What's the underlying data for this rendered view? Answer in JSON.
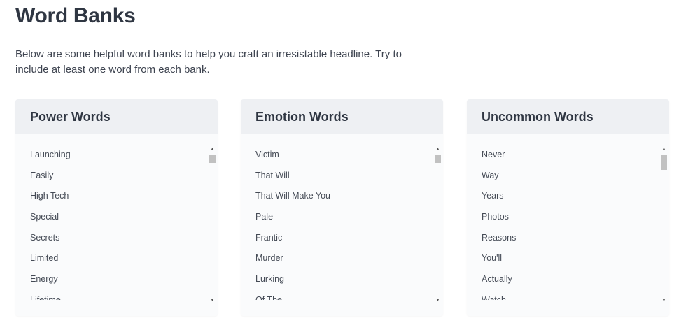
{
  "page": {
    "title": "Word Banks",
    "intro": "Below are some helpful word banks to help you craft an irresistable headline. Try to include at least one word from each bank."
  },
  "banks": [
    {
      "title": "Power Words",
      "items": [
        "Launching",
        "Easily",
        "High Tech",
        "Special",
        "Secrets",
        "Limited",
        "Energy",
        "Lifetime"
      ]
    },
    {
      "title": "Emotion Words",
      "items": [
        "Victim",
        "That Will",
        "That Will Make You",
        "Pale",
        "Frantic",
        "Murder",
        "Lurking",
        "Of The"
      ]
    },
    {
      "title": "Uncommon Words",
      "items": [
        "Never",
        "Way",
        "Years",
        "Photos",
        "Reasons",
        "You'll",
        "Actually",
        "Watch"
      ]
    }
  ],
  "icons": {
    "scroll_up": "scroll-up-arrow-icon",
    "scroll_down": "scroll-down-arrow-icon"
  }
}
